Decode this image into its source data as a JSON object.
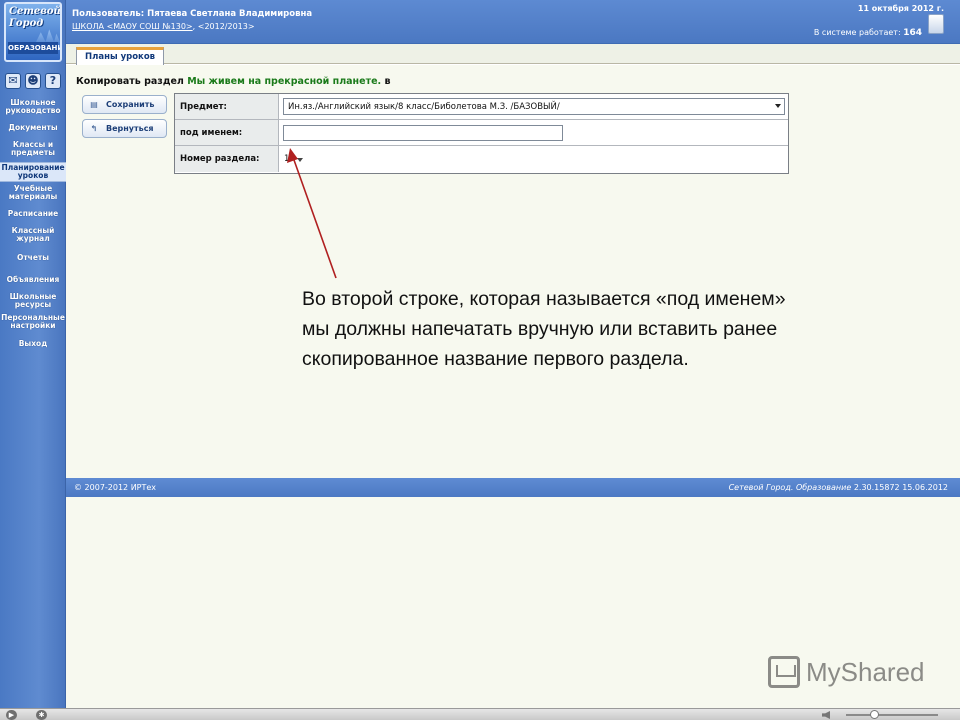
{
  "logo": {
    "line1": "Сетевой",
    "line2": "Город",
    "line3": "ОБРАЗОВАНИЕ"
  },
  "side_icons": [
    {
      "name": "mail-icon",
      "glyph": "✉"
    },
    {
      "name": "users-icon",
      "glyph": "☻"
    },
    {
      "name": "help-icon",
      "glyph": "?"
    }
  ],
  "menu": [
    "Школьное руководство",
    "Документы",
    "Классы и предметы",
    "Планирование уроков",
    "Учебные материалы",
    "Расписание",
    "Классный журнал",
    "Отчеты",
    "Объявления",
    "Школьные ресурсы",
    "Персональные настройки",
    "Выход"
  ],
  "menu_active": "Планирование уроков",
  "header": {
    "user_label": "Пользователь:",
    "user_name": "Пятаева Светлана Владимировна",
    "school_link": "ШКОЛА <МАОУ СОШ №130>",
    "year": "<2012/2013>",
    "date": "11 октября 2012 г.",
    "online_label": "В системе работает:",
    "online_count": "164"
  },
  "tab": {
    "label": "Планы уроков"
  },
  "page": {
    "title_prefix": "Копировать раздел",
    "title_section": "Мы живем на прекрасной планете.",
    "title_suffix": "в"
  },
  "buttons": {
    "save": "Сохранить",
    "back": "Вернуться"
  },
  "form": {
    "subject_label": "Предмет:",
    "subject_value": "Ин.яз./Английский язык/8 класс/Биболетова М.З. /БАЗОВЫЙ/",
    "name_label": "под именем:",
    "name_value": "",
    "section_label": "Номер раздела:",
    "section_value": "1"
  },
  "annotation": {
    "lines": [
      "Во второй строке, которая называется «под именем»",
      "мы должны напечатать вручную или вставить ранее",
      "скопированное название первого раздела."
    ]
  },
  "footer": {
    "copyright": "© 2007-2012 ИРТех",
    "product": "Сетевой Город. Образование",
    "version": "2.30.15872",
    "build_date": "15.06.2012"
  },
  "watermark": {
    "text": "MyShared"
  },
  "colors": {
    "header_blue": "#4b78c2",
    "tab_accent": "#e8a23c",
    "section_green": "#1a7a1a",
    "arrow_red": "#b02020"
  }
}
